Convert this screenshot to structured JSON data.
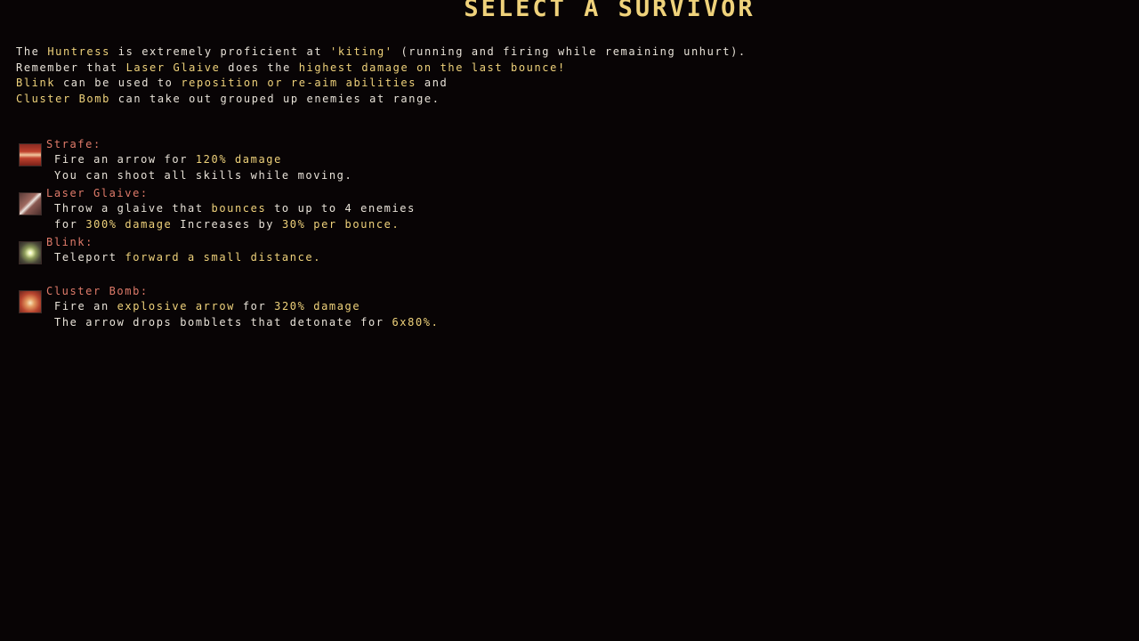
{
  "title": "SELECT A SURVIVOR",
  "colors": {
    "background": "#080405",
    "text": "#e8e2d8",
    "highlight": "#efd27b",
    "skill_name": "#e07b6a"
  },
  "intro": {
    "line1": {
      "a": "The",
      "b": "Huntress",
      "c": "is extremely proficient at",
      "d": "'kiting'",
      "e": "(running and firing while remaining unhurt)."
    },
    "line2": {
      "a": "Remember that",
      "b": "Laser Glaive",
      "c": "does the",
      "d": "highest damage on the last bounce!"
    },
    "line3": {
      "a": "Blink",
      "b": "can be used to",
      "c": "reposition or re-aim abilities",
      "d": "and"
    },
    "line4": {
      "a": "Cluster Bomb",
      "b": "can take out grouped up enemies at range."
    }
  },
  "skills": {
    "strafe": {
      "icon": "strafe-arrow-icon",
      "name": "Strafe:",
      "l1a": "Fire an arrow for",
      "l1b": "120% damage",
      "l2a": "You can shoot all skills while moving."
    },
    "glaive": {
      "icon": "laser-glaive-icon",
      "name": "Laser Glaive:",
      "l1a": "Throw a glaive that",
      "l1b": "bounces",
      "l1c": "to up to 4 enemies",
      "l2a": "for",
      "l2b": "300% damage",
      "l2c": "Increases by",
      "l2d": "30% per bounce."
    },
    "blink": {
      "icon": "blink-sparkle-icon",
      "name": "Blink:",
      "l1a": "Teleport",
      "l1b": "forward a small distance."
    },
    "bomb": {
      "icon": "cluster-bomb-icon",
      "name": "Cluster Bomb:",
      "l1a": "Fire an",
      "l1b": "explosive arrow",
      "l1c": "for",
      "l1d": "320% damage",
      "l2a": "The arrow drops bomblets that detonate for",
      "l2b": "6x80%."
    }
  }
}
